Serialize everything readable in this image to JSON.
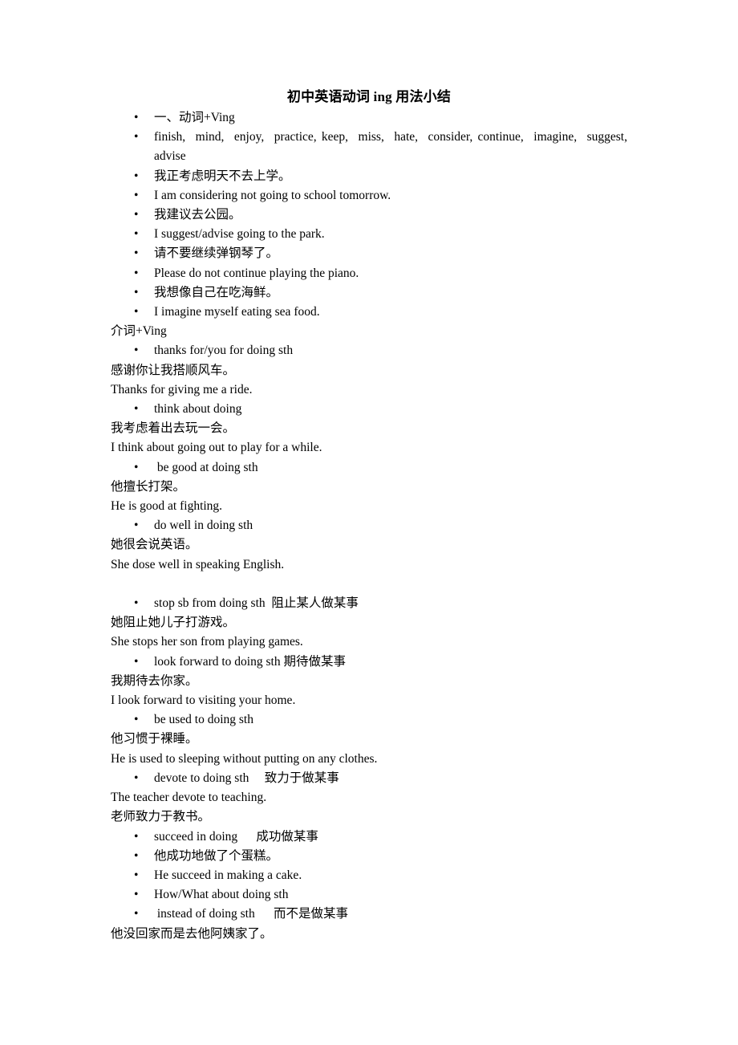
{
  "document": {
    "title": "初中英语动词 ing 用法小结",
    "bullet_glyph": "•",
    "lines": [
      {
        "id": "l1",
        "style": "bullet",
        "text": "一、动词+Ving"
      },
      {
        "id": "l2",
        "style": "bullet-justified",
        "text": "finish,  mind,  enjoy,  practice, keep,  miss,  hate,  consider, continue,  imagine,  suggest,  advise"
      },
      {
        "id": "l3",
        "style": "bullet",
        "text": "我正考虑明天不去上学。"
      },
      {
        "id": "l4",
        "style": "bullet",
        "text": "I am considering not going to school tomorrow."
      },
      {
        "id": "l5",
        "style": "bullet",
        "text": "我建议去公园。"
      },
      {
        "id": "l6",
        "style": "bullet",
        "text": "I suggest/advise going to the park."
      },
      {
        "id": "l7",
        "style": "bullet",
        "text": "请不要继续弹钢琴了。"
      },
      {
        "id": "l8",
        "style": "bullet",
        "text": "Please do not continue playing the piano."
      },
      {
        "id": "l9",
        "style": "bullet",
        "text": "我想像自己在吃海鲜。"
      },
      {
        "id": "l10",
        "style": "bullet",
        "text": "I imagine myself eating sea food."
      },
      {
        "id": "l11",
        "style": "plain",
        "text": "介词+Ving"
      },
      {
        "id": "l12",
        "style": "bullet",
        "text": "thanks for/you for doing sth"
      },
      {
        "id": "l13",
        "style": "plain",
        "text": "感谢你让我搭顺风车。"
      },
      {
        "id": "l14",
        "style": "plain",
        "text": "Thanks for giving me a ride."
      },
      {
        "id": "l15",
        "style": "bullet",
        "text": "think about doing"
      },
      {
        "id": "l16",
        "style": "plain",
        "text": "我考虑着出去玩一会。"
      },
      {
        "id": "l17",
        "style": "plain",
        "text": "I think about going out to play for a while."
      },
      {
        "id": "l18",
        "style": "bullet",
        "text": " be good at doing sth"
      },
      {
        "id": "l19",
        "style": "plain",
        "text": "他擅长打架。"
      },
      {
        "id": "l20",
        "style": "plain",
        "text": "He is good at fighting."
      },
      {
        "id": "l21",
        "style": "bullet",
        "text": "do well in doing sth"
      },
      {
        "id": "l22",
        "style": "plain",
        "text": "她很会说英语。"
      },
      {
        "id": "l23",
        "style": "plain",
        "text": "She dose well in speaking English."
      },
      {
        "id": "l24",
        "style": "blank",
        "text": ""
      },
      {
        "id": "l25",
        "style": "bullet",
        "text": "stop sb from doing sth  阻止某人做某事"
      },
      {
        "id": "l26",
        "style": "plain",
        "text": "她阻止她儿子打游戏。"
      },
      {
        "id": "l27",
        "style": "plain",
        "text": "She stops her son from playing games."
      },
      {
        "id": "l28",
        "style": "bullet",
        "text": "look forward to doing sth 期待做某事"
      },
      {
        "id": "l29",
        "style": "plain",
        "text": "我期待去你家。"
      },
      {
        "id": "l30",
        "style": "plain",
        "text": "I look forward to visiting your home."
      },
      {
        "id": "l31",
        "style": "bullet",
        "text": "be used to doing sth"
      },
      {
        "id": "l32",
        "style": "plain",
        "text": "他习惯于裸睡。"
      },
      {
        "id": "l33",
        "style": "plain",
        "text": "He is used to sleeping without putting on any clothes."
      },
      {
        "id": "l34",
        "style": "bullet",
        "text": "devote to doing sth     致力于做某事"
      },
      {
        "id": "l35",
        "style": "plain",
        "text": "The teacher devote to teaching."
      },
      {
        "id": "l36",
        "style": "plain",
        "text": "老师致力于教书。"
      },
      {
        "id": "l37",
        "style": "bullet",
        "text": "succeed in doing      成功做某事"
      },
      {
        "id": "l38",
        "style": "bullet",
        "text": "他成功地做了个蛋糕。"
      },
      {
        "id": "l39",
        "style": "bullet",
        "text": "He succeed in making a cake."
      },
      {
        "id": "l40",
        "style": "bullet",
        "text": "How/What about doing sth"
      },
      {
        "id": "l41",
        "style": "bullet",
        "text": " instead of doing sth      而不是做某事"
      },
      {
        "id": "l42",
        "style": "plain",
        "text": "他没回家而是去他阿姨家了。"
      }
    ]
  }
}
